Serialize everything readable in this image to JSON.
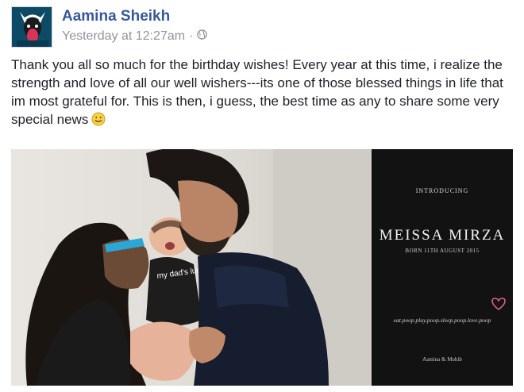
{
  "post": {
    "author": "Aamina Sheikh",
    "timestamp": "Yesterday at 12:27am",
    "separator": "·",
    "privacy_icon": "globe-icon",
    "text": "Thank you all so much for the birthday wishes! Every year at this time, i realize the strength and love of all our well wishers---its one of those blessed things in life that im most grateful for. This is then, i guess, the best time as any to share some very special news",
    "text_emoji": "smile-emoji"
  },
  "photo": {
    "shirt_text": "my dad's lucky",
    "card": {
      "introducing": "INTRODUCING",
      "baby_name": "MEISSA MIRZA",
      "born": "BORN 11TH AUGUST 2015",
      "motto": "eat.poop.play.poop.sleep.poop.love.poop",
      "signature": "Aamina & Mohib",
      "heart_icon": "heart-icon"
    }
  },
  "colors": {
    "author_link": "#365899",
    "meta_text": "#90949c",
    "card_background": "#121212",
    "heart": "#e0607e"
  }
}
